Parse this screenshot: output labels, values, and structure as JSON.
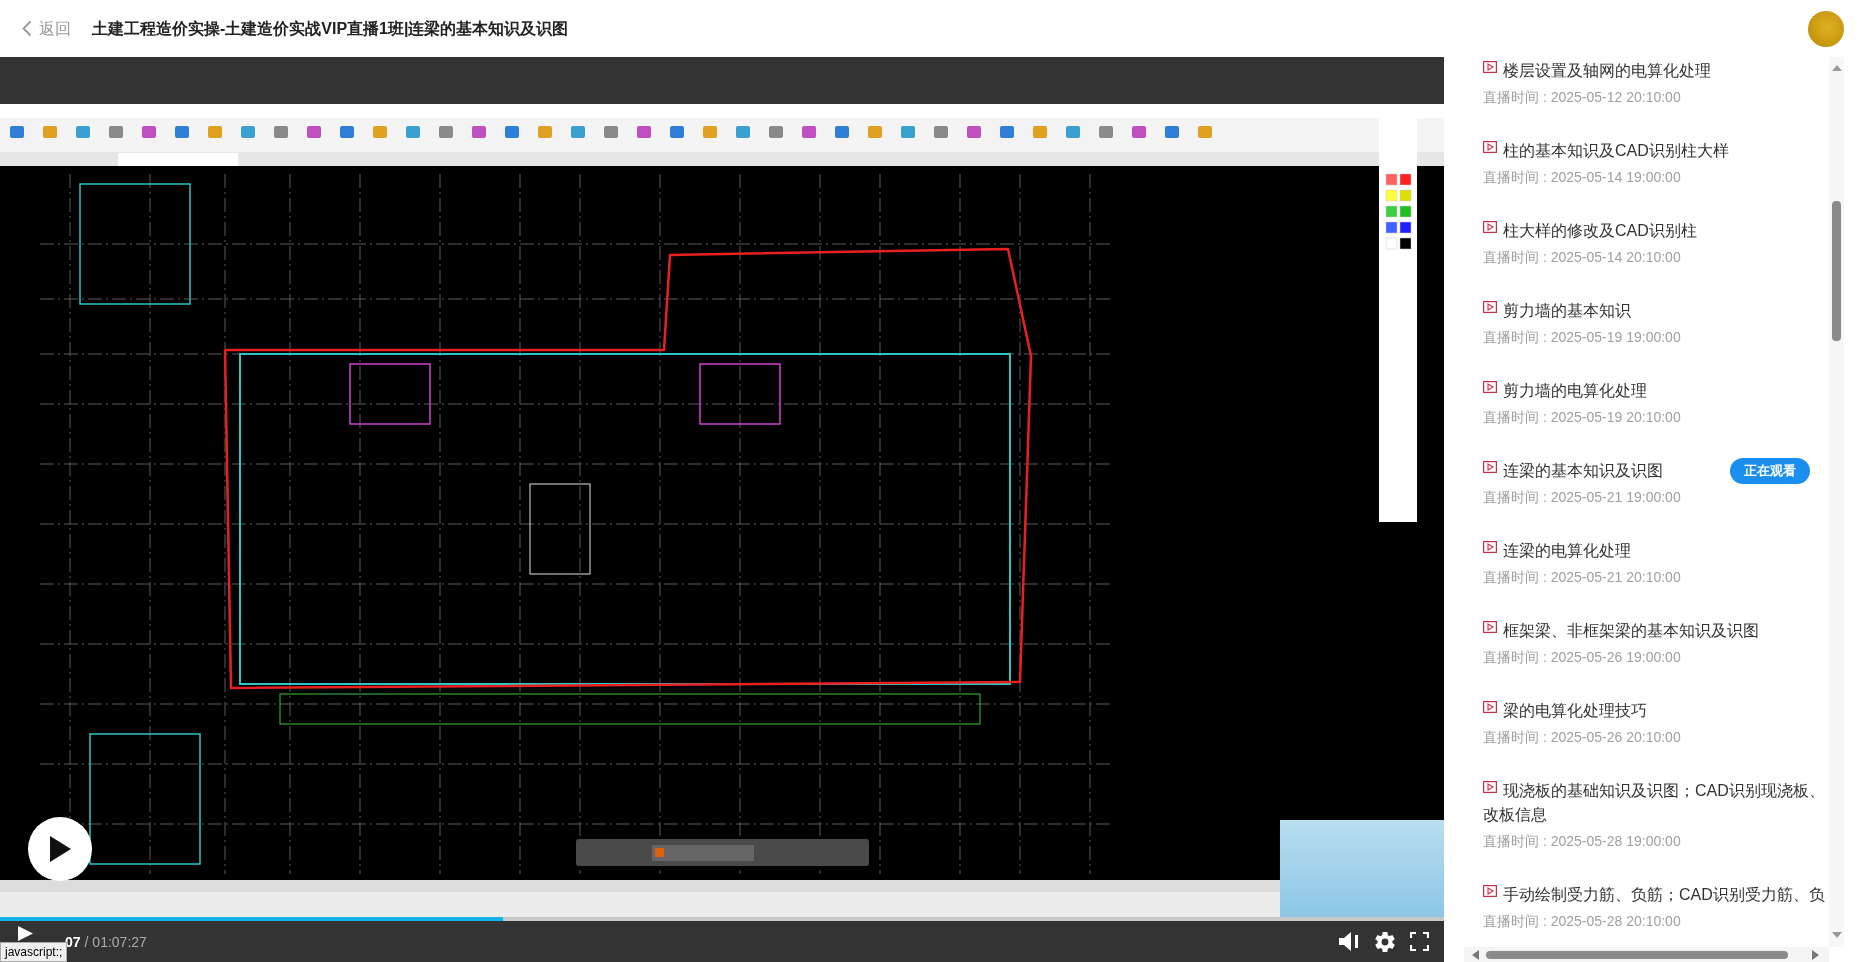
{
  "header": {
    "back_label": "返回",
    "title": "土建工程造价实操-土建造价实战VIP直播1班|连梁的基本知识及识图"
  },
  "player": {
    "progress": {
      "level": 0.348
    },
    "current_time": "07",
    "total_time": "/ 01:07:27",
    "status_tooltip": "javascript:;"
  },
  "lesson_list": {
    "now_watching_label": "正在观看",
    "items": [
      {
        "title": "楼层设置及轴网的电算化处理",
        "time": "直播时间 : 2025-05-12 20:10:00",
        "selected": false
      },
      {
        "title": "柱的基本知识及CAD识别柱大样",
        "time": "直播时间 : 2025-05-14 19:00:00",
        "selected": false
      },
      {
        "title": "柱大样的修改及CAD识别柱",
        "time": "直播时间 : 2025-05-14 20:10:00",
        "selected": false
      },
      {
        "title": "剪力墙的基本知识",
        "time": "直播时间 : 2025-05-19 19:00:00",
        "selected": false
      },
      {
        "title": "剪力墙的电算化处理",
        "time": "直播时间 : 2025-05-19 20:10:00",
        "selected": false
      },
      {
        "title": "连梁的基本知识及识图",
        "time": "直播时间 : 2025-05-21 19:00:00",
        "selected": true
      },
      {
        "title": "连梁的电算化处理",
        "time": "直播时间 : 2025-05-21 20:10:00",
        "selected": false
      },
      {
        "title": "框架梁、非框架梁的基本知识及识图",
        "time": "直播时间 : 2025-05-26 19:00:00",
        "selected": false
      },
      {
        "title": "梁的电算化处理技巧",
        "time": "直播时间 : 2025-05-26 20:10:00",
        "selected": false
      },
      {
        "title": "现浇板的基础知识及识图；CAD识别现浇板、改板信息",
        "time": "直播时间 : 2025-05-28 19:00:00",
        "selected": false
      },
      {
        "title": "手动绘制受力筋、负筋；CAD识别受力筋、负",
        "time": "直播时间 : 2025-05-28 20:10:00",
        "selected": false
      }
    ]
  }
}
